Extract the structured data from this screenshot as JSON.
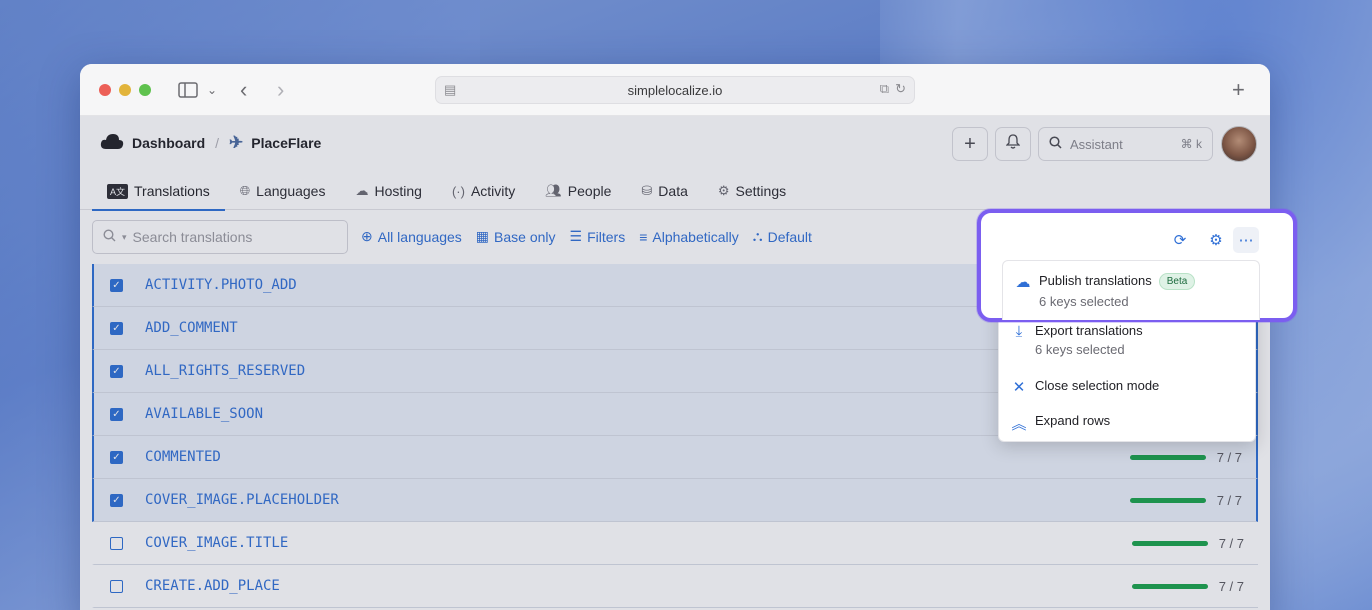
{
  "browser": {
    "url": "simplelocalize.io",
    "new_tab": "+"
  },
  "header": {
    "dashboard": "Dashboard",
    "separator": "/",
    "project_name": "PlaceFlare",
    "assistant_placeholder": "Assistant",
    "assistant_shortcut": "⌘ k",
    "add_label": "+"
  },
  "tabs": [
    {
      "label": "Translations",
      "icon": "translate-icon"
    },
    {
      "label": "Languages",
      "icon": "globe-icon"
    },
    {
      "label": "Hosting",
      "icon": "cloud-icon"
    },
    {
      "label": "Activity",
      "icon": "broadcast-icon"
    },
    {
      "label": "People",
      "icon": "people-icon"
    },
    {
      "label": "Data",
      "icon": "database-icon"
    },
    {
      "label": "Settings",
      "icon": "gear-icon"
    }
  ],
  "toolbar": {
    "search_placeholder": "Search translations",
    "filters": [
      "All languages",
      "Base only",
      "Filters",
      "Alphabetically",
      "Default"
    ]
  },
  "rows": [
    {
      "key": "ACTIVITY.PHOTO_ADD",
      "selected": true,
      "progress": ""
    },
    {
      "key": "ADD_COMMENT",
      "selected": true,
      "progress": ""
    },
    {
      "key": "ALL_RIGHTS_RESERVED",
      "selected": true,
      "progress": ""
    },
    {
      "key": "AVAILABLE_SOON",
      "selected": true,
      "progress": ""
    },
    {
      "key": "COMMENTED",
      "selected": true,
      "progress": "7 / 7"
    },
    {
      "key": "COVER_IMAGE.PLACEHOLDER",
      "selected": true,
      "progress": "7 / 7"
    },
    {
      "key": "COVER_IMAGE.TITLE",
      "selected": false,
      "progress": "7 / 7"
    },
    {
      "key": "CREATE.ADD_PLACE",
      "selected": false,
      "progress": "7 / 7"
    }
  ],
  "menu": {
    "publish": {
      "title": "Publish translations",
      "badge": "Beta",
      "subtitle": "6 keys selected"
    },
    "export": {
      "title": "Export translations",
      "subtitle": "6 keys selected"
    },
    "close": {
      "title": "Close selection mode"
    },
    "expand": {
      "title": "Expand rows"
    }
  },
  "colors": {
    "accent": "#2f6fd6",
    "progress": "#18a34a",
    "highlight": "#7b5ef0"
  }
}
